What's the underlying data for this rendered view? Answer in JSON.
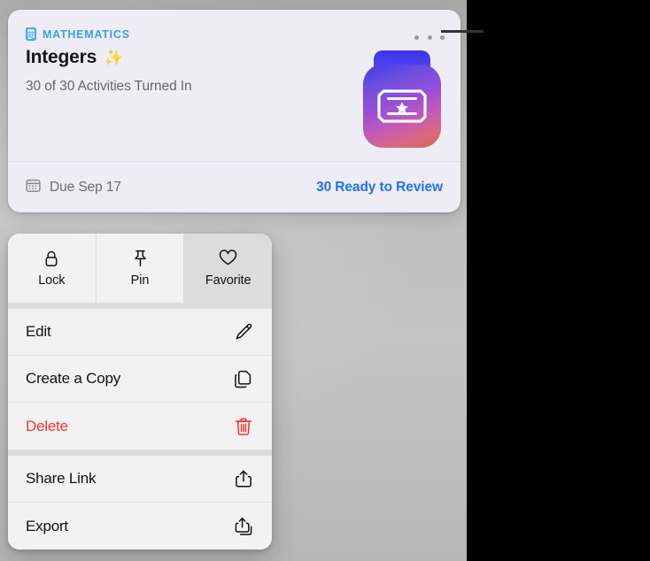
{
  "card": {
    "subject": "MATHEMATICS",
    "subject_icon": "calculator-icon",
    "title": "Integers",
    "title_emoji": "✨",
    "subtitle": "30 of 30 Activities Turned In",
    "more_icon": "ellipsis-icon",
    "artwork_icon": "app-artwork-ticket-star",
    "due_icon": "calendar-icon",
    "due_text": "Due Sep 17",
    "review_text": "30 Ready to Review",
    "accent_blue": "#1f72ef",
    "subject_blue": "#3aa0e8",
    "background": "#eeedf6"
  },
  "menu": {
    "quick_actions": [
      {
        "label": "Lock",
        "icon": "lock-icon",
        "selected": false
      },
      {
        "label": "Pin",
        "icon": "pin-icon",
        "selected": false
      },
      {
        "label": "Favorite",
        "icon": "heart-icon",
        "selected": true
      }
    ],
    "groups": [
      [
        {
          "label": "Edit",
          "icon": "pencil-icon",
          "danger": false
        },
        {
          "label": "Create a Copy",
          "icon": "duplicate-icon",
          "danger": false
        },
        {
          "label": "Delete",
          "icon": "trash-icon",
          "danger": true
        }
      ],
      [
        {
          "label": "Share Link",
          "icon": "share-icon",
          "danger": false
        },
        {
          "label": "Export",
          "icon": "export-stack-icon",
          "danger": false
        }
      ]
    ],
    "danger_color": "#f8312f",
    "selected_bg": "#dcdcdc"
  }
}
